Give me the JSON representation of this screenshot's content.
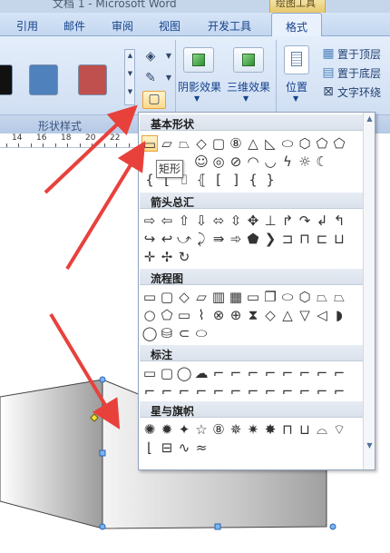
{
  "window": {
    "title": "文档 1 - Microsoft Word",
    "context_tab_group": "绘图工具"
  },
  "tabs": [
    {
      "label": "引用",
      "active": false
    },
    {
      "label": "邮件",
      "active": false
    },
    {
      "label": "审阅",
      "active": false
    },
    {
      "label": "视图",
      "active": false
    },
    {
      "label": "开发工具",
      "active": false
    },
    {
      "label": "格式",
      "active": true
    }
  ],
  "ribbon": {
    "shape_style_swatches": [
      "#111111",
      "#4f81bd",
      "#c0504d"
    ],
    "shape_style_group_label": "形状样式",
    "shadow_effects_label": "阴影效果",
    "three_d_effects_label": "三维效果",
    "position_label": "位置",
    "bring_to_front_label": "置于顶层",
    "send_to_back_label": "置于底层",
    "text_wrap_label": "文字环绕"
  },
  "ruler": {
    "numbers": [
      "14",
      "16",
      "18",
      "20",
      "22"
    ]
  },
  "shapes_panel": {
    "sections": [
      {
        "title": "基本形状"
      },
      {
        "title": "箭头总汇"
      },
      {
        "title": "流程图"
      },
      {
        "title": "标注"
      },
      {
        "title": "星与旗帜"
      }
    ],
    "tooltip": "矩形"
  },
  "colors": {
    "accent_highlight": "#ffd98a",
    "ribbon_bg": "#d3e1f4",
    "arrow_red": "#e8413c"
  }
}
